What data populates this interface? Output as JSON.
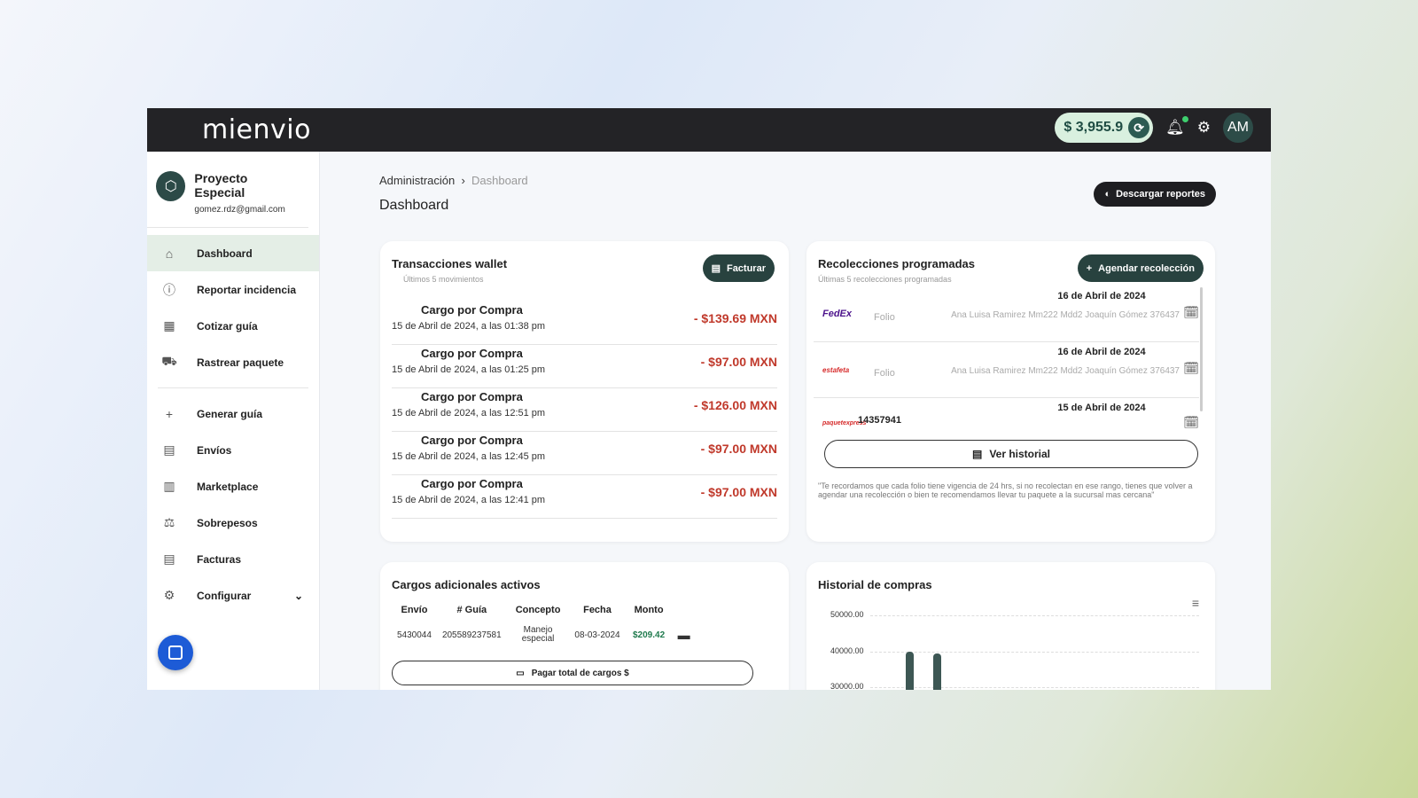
{
  "header": {
    "logo": "mienvio",
    "balance": "$ 3,955.9",
    "avatar": "AM"
  },
  "profile": {
    "name": "Proyecto Especial",
    "email": "gomez.rdz@gmail.com"
  },
  "sidebar": {
    "items": [
      {
        "label": "Dashboard",
        "icon": "home-icon",
        "active": true
      },
      {
        "label": "Reportar incidencia",
        "icon": "alert-circle-icon"
      },
      {
        "label": "Cotizar guía",
        "icon": "calculator-icon"
      },
      {
        "label": "Rastrear paquete",
        "icon": "truck-icon"
      },
      {
        "label": "Generar guía",
        "icon": "plus-icon"
      },
      {
        "label": "Envíos",
        "icon": "document-icon"
      },
      {
        "label": "Marketplace",
        "icon": "store-icon"
      },
      {
        "label": "Sobrepesos",
        "icon": "scale-icon"
      },
      {
        "label": "Facturas",
        "icon": "invoice-icon"
      },
      {
        "label": "Configurar",
        "icon": "gear-icon"
      }
    ]
  },
  "breadcrumb": {
    "parent": "Administración",
    "current": "Dashboard"
  },
  "page_title": "Dashboard",
  "download_label": "Descargar reportes",
  "wallet": {
    "title": "Transacciones wallet",
    "subtitle": "Últimos 5 movimientos",
    "button": "Facturar",
    "items": [
      {
        "concept": "Cargo por Compra",
        "date": "15 de Abril de 2024, a las 01:38 pm",
        "amount": "- $139.69 MXN"
      },
      {
        "concept": "Cargo por Compra",
        "date": "15 de Abril de 2024, a las 01:25 pm",
        "amount": "- $97.00 MXN"
      },
      {
        "concept": "Cargo por Compra",
        "date": "15 de Abril de 2024, a las 12:51 pm",
        "amount": "- $126.00 MXN"
      },
      {
        "concept": "Cargo por Compra",
        "date": "15 de Abril de 2024, a las 12:45 pm",
        "amount": "- $97.00 MXN"
      },
      {
        "concept": "Cargo por Compra",
        "date": "15 de Abril de 2024, a las 12:41 pm",
        "amount": "- $97.00 MXN"
      }
    ]
  },
  "pickups": {
    "title": "Recolecciones programadas",
    "subtitle": "Últimas 5 recolecciones programadas",
    "button": "Agendar recolección",
    "items": [
      {
        "carrier": "FedEx",
        "folio": "Folio",
        "date": "16 de Abril de 2024",
        "address": "Ana Luisa Ramirez Mm222 Mdd2 Joaquín Gómez 376437"
      },
      {
        "carrier": "estafeta",
        "folio": "Folio",
        "date": "16 de Abril de 2024",
        "address": "Ana Luisa Ramirez Mm222 Mdd2 Joaquín Gómez 376437"
      },
      {
        "carrier": "paquetexpress",
        "folio": "14357941",
        "date": "15 de Abril de 2024",
        "address": ""
      }
    ],
    "history_button": "Ver historial",
    "note": "\"Te recordamos que cada folio tiene vigencia de 24 hrs, si no recolectan en ese rango, tienes que volver a agendar una recolección o bien te recomendamos llevar tu paquete a la sucursal mas cercana\""
  },
  "charges": {
    "title": "Cargos adicionales activos",
    "columns": [
      "Envío",
      "# Guía",
      "Concepto",
      "Fecha",
      "Monto"
    ],
    "rows": [
      {
        "envio": "5430044",
        "guia": "205589237581",
        "concepto": "Manejo especial",
        "fecha": "08-03-2024",
        "monto": "$209.42"
      }
    ],
    "pay_button": "Pagar total de cargos $"
  },
  "purchases": {
    "title": "Historial de compras"
  },
  "chart_data": {
    "type": "bar",
    "yticks": [
      "50000.00",
      "40000.00",
      "30000.00"
    ],
    "values": [
      40000,
      39500
    ],
    "ylim_visible": [
      30000,
      50000
    ],
    "grid": true,
    "bar_color": "#3d5754"
  },
  "colors": {
    "accent": "#28423f",
    "negative": "#c0392b",
    "positive": "#1f7a4d"
  }
}
